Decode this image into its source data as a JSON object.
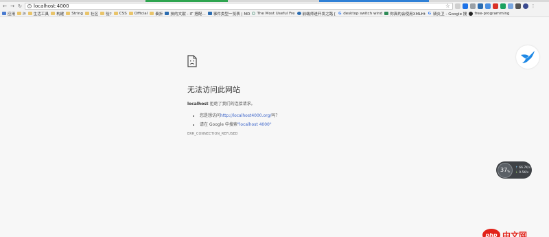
{
  "browser": {
    "url": "localhost:4000",
    "bookmarks": [
      {
        "label": "应用",
        "icon": "apps-icon"
      },
      {
        "label": "js",
        "icon": "folder-icon"
      },
      {
        "label": "生活工具",
        "icon": "folder-icon"
      },
      {
        "label": "构建",
        "icon": "folder-icon"
      },
      {
        "label": "String",
        "icon": "folder-icon"
      },
      {
        "label": "社区",
        "icon": "folder-icon"
      },
      {
        "label": "验?",
        "icon": "folder-icon"
      },
      {
        "label": "CSS",
        "icon": "folder-icon"
      },
      {
        "label": "Official",
        "icon": "folder-icon"
      },
      {
        "label": "奏折",
        "icon": "folder-icon"
      },
      {
        "label": "技的文献 - IT 搭配...",
        "icon": "site-icon"
      },
      {
        "label": "事件类型一览表 | MD",
        "icon": "site-icon"
      },
      {
        "label": "The Most Useful Fre",
        "icon": "site-icon"
      },
      {
        "label": "前端师进开发之路 [",
        "icon": "site-icon"
      },
      {
        "label": "desktop switch wind",
        "icon": "google-icon"
      },
      {
        "label": "你真的会使用XMLHt",
        "icon": "site-icon"
      },
      {
        "label": "骑炎卫 - Google 搜",
        "icon": "google-icon"
      },
      {
        "label": "free-programming",
        "icon": "github-icon"
      }
    ]
  },
  "error_page": {
    "title": "无法访问此网站",
    "host": "localhost",
    "message": " 拒绝了我们的连接请求。",
    "tip1_prefix": "您是想访问",
    "tip1_link": "http://localhost4000.org/",
    "tip1_suffix": "吗？",
    "tip2_prefix": "请在 Google 中搜索",
    "tip2_link": "\"localhost 4000\"",
    "error_code": "ERR_CONNECTION_REFUSED"
  },
  "speed_widget": {
    "percent": "37",
    "percent_unit": "%",
    "up_rate": "66.7",
    "up_unit": "K/s",
    "down_rate": "0.5",
    "down_unit": "K/s"
  },
  "watermark": {
    "logo": "php",
    "text": "中文网"
  }
}
